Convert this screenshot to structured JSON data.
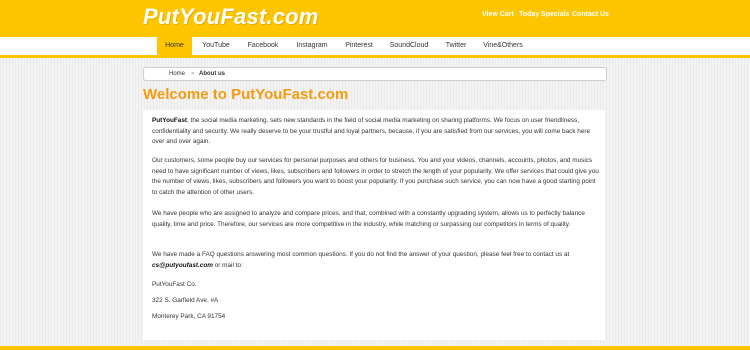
{
  "header": {
    "logo": "PutYouFast.com",
    "links": [
      "View Cart",
      "Today Specials",
      "Contact Us"
    ]
  },
  "nav": {
    "items": [
      "Home",
      "YouTube",
      "Facebook",
      "Instagram",
      "Pinterest",
      "SoundCloud",
      "Twitter",
      "Vine&Others"
    ],
    "active": "Home"
  },
  "breadcrumb": {
    "home": "Home",
    "separator": "»",
    "current": "About us"
  },
  "page": {
    "title": "Welcome to PutYouFast.com",
    "p1_brand": "PutYouFast",
    "p1_text": ", the social media marketing, sets new standards in the field of social media marketing on sharing platforms. We focus on user friendliness, confidentiality and security. We really deserve to be your trustful and loyal partners, because, if you are satisfied from our services, you will come back here over and over again.",
    "p2": "Our customers, some people buy our services for personal purposes and others for business. You and your videos, channels, accounts, photos, and musics need to have significant number of views, likes, subscribers and followers in order to stretch the length of your popularity. We offer services that could give you the number of views, likes, subscribers and followers you want to boost your popularity. If you purchase such service, you can now have a good starting point to catch the attention of other users.",
    "p3": "We have people who are assigned to analyze and compare prices, and that, combined with a constantly upgrading system, allows us to perfectly balance quality, time and price. Therefore, our services are more competitive in the industry, while matching or surpassing our competitors in terms of quality.",
    "p4_text": "We have made a FAQ questions answering most common questions. If you do not find the answer of your question, please feel free to contact us at ",
    "p4_email": "cs@putyoufast.com",
    "p4_tail": " or mail to:",
    "address": [
      "PutYouFast Co.",
      "322 S. Garfield Ave. #A",
      "Monterey Park, CA 91754"
    ]
  },
  "colors": {
    "accent": "#fec601",
    "heading": "#f39c12"
  }
}
